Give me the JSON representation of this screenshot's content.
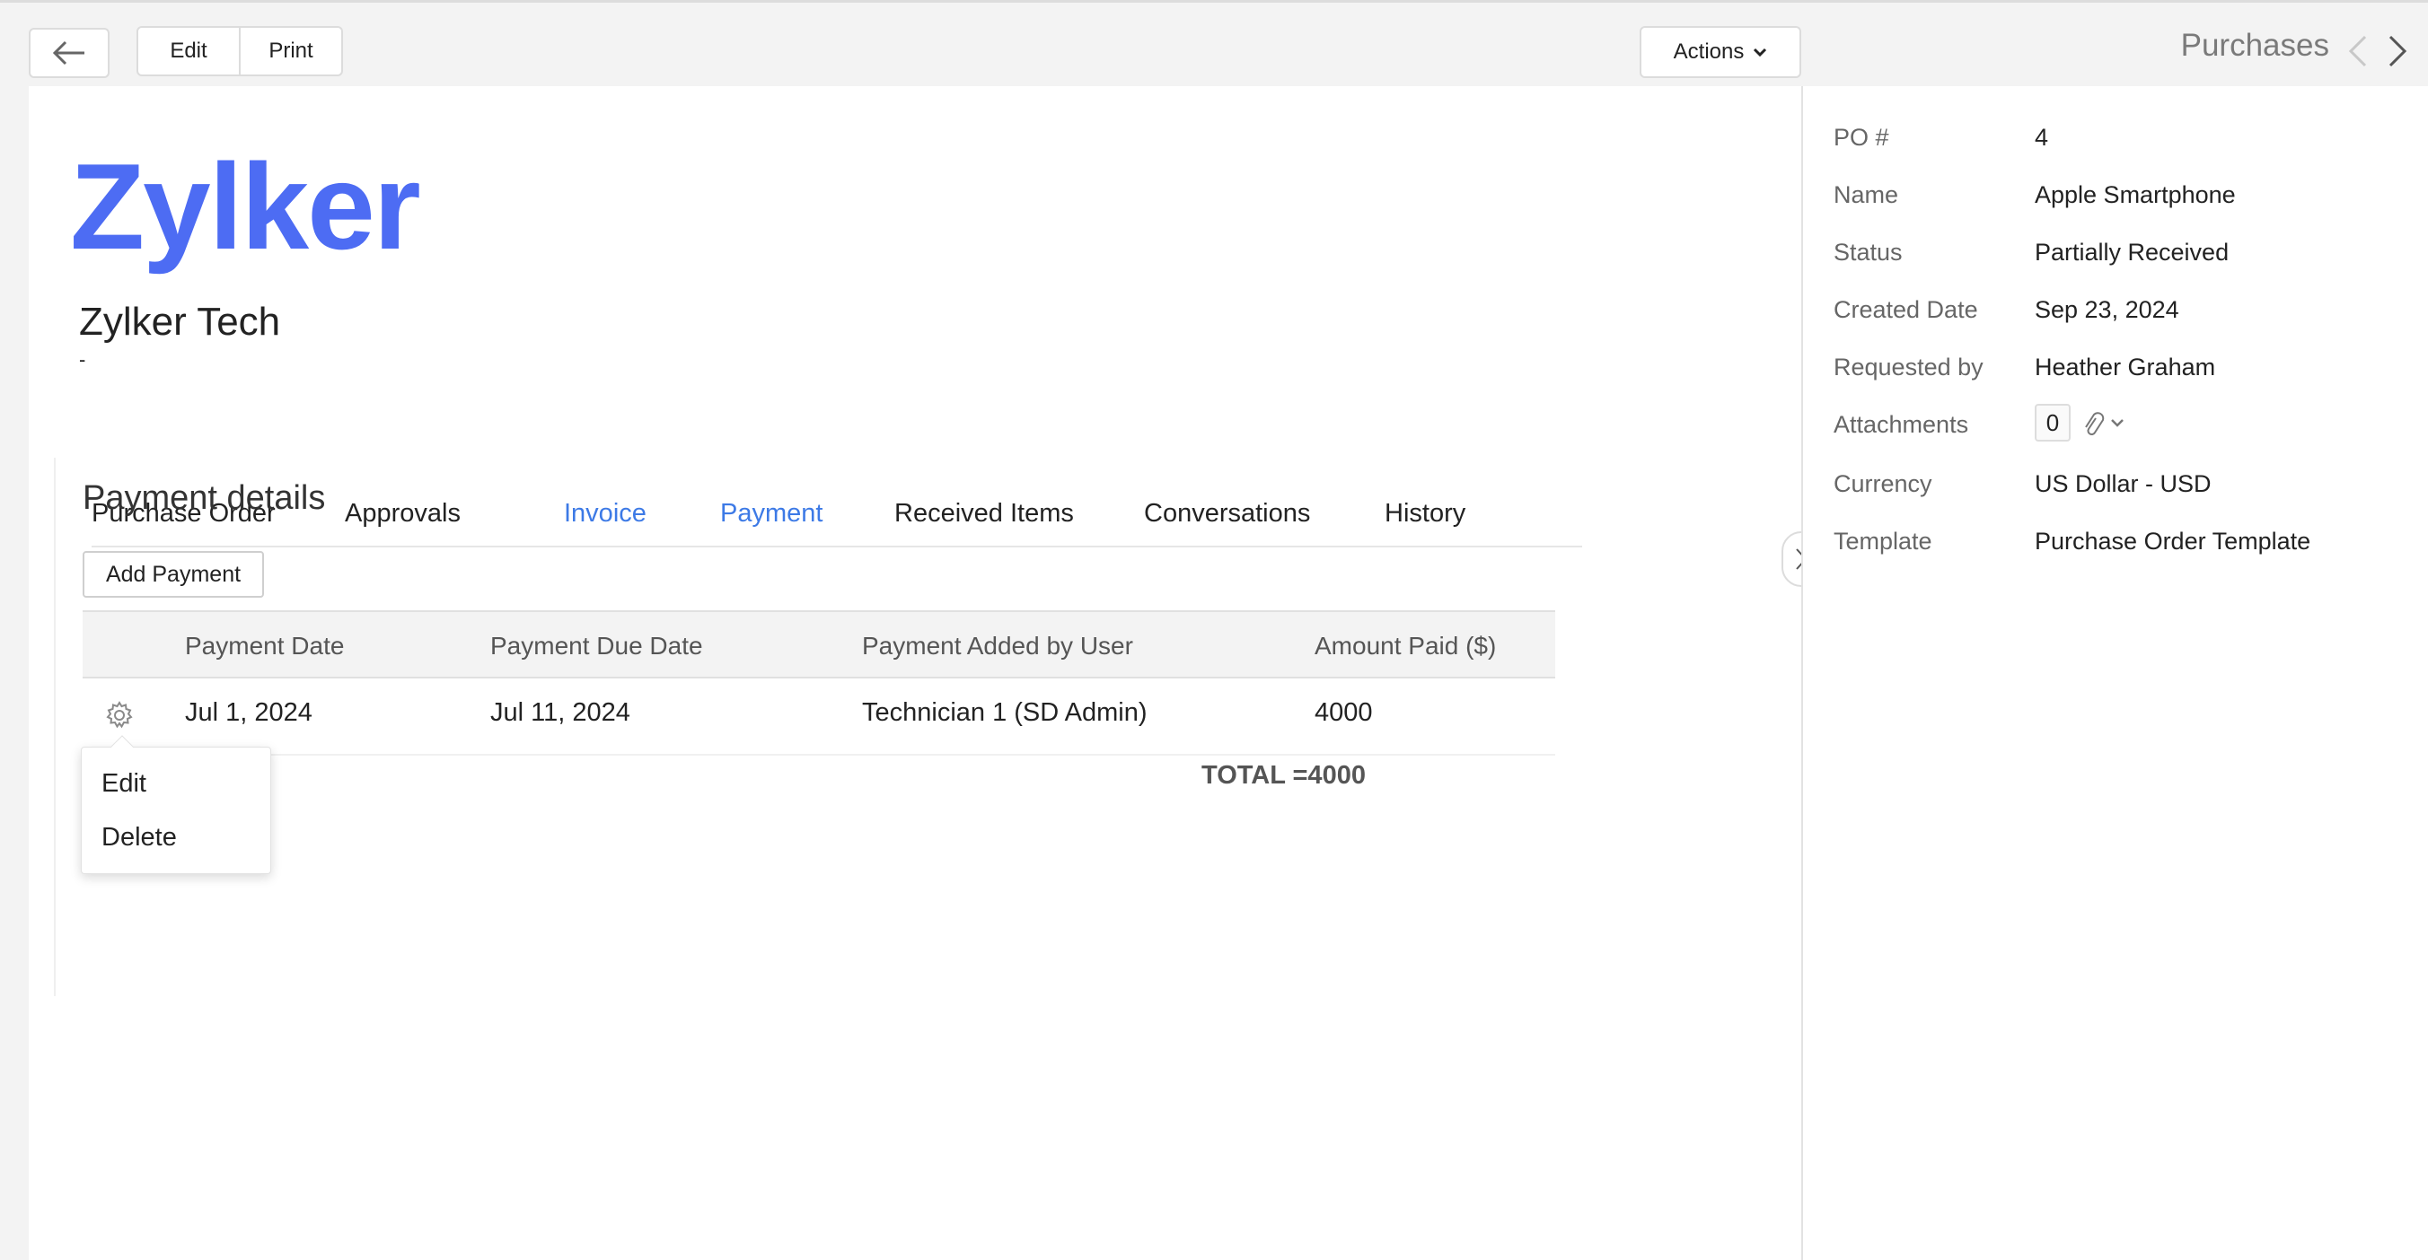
{
  "toolbar": {
    "edit_label": "Edit",
    "print_label": "Print",
    "actions_label": "Actions",
    "module_title": "Purchases"
  },
  "header": {
    "logo_text": "Zylker",
    "org_name": "Zylker Tech",
    "org_sub": "-"
  },
  "tabs": [
    {
      "label": "Purchase Order"
    },
    {
      "label": "Approvals"
    },
    {
      "label": "Invoice"
    },
    {
      "label": "Payment"
    },
    {
      "label": "Received Items"
    },
    {
      "label": "Conversations"
    },
    {
      "label": "History"
    }
  ],
  "payment": {
    "section_title": "Payment details",
    "add_button": "Add Payment",
    "columns": [
      "Payment Date",
      "Payment Due Date",
      "Payment Added by User",
      "Amount Paid ($)"
    ],
    "rows": [
      {
        "date": "Jul 1, 2024",
        "due_date": "Jul 11, 2024",
        "added_by": "Technician 1 (SD Admin)",
        "amount": "4000"
      }
    ],
    "total": "TOTAL =4000"
  },
  "row_menu": {
    "items": [
      "Edit",
      "Delete"
    ]
  },
  "details": {
    "po_label": "PO #",
    "po_value": "4",
    "name_label": "Name",
    "name_value": "Apple Smartphone",
    "status_label": "Status",
    "status_value": "Partially Received",
    "created_label": "Created Date",
    "created_value": "Sep 23, 2024",
    "requested_label": "Requested by",
    "requested_value": "Heather Graham",
    "attachments_label": "Attachments",
    "attachments_value": "0",
    "currency_label": "Currency",
    "currency_value": "US Dollar - USD",
    "template_label": "Template",
    "template_value": "Purchase Order Template"
  },
  "colors": {
    "brand": "#4d6cf3",
    "link": "#3d7ae6"
  }
}
